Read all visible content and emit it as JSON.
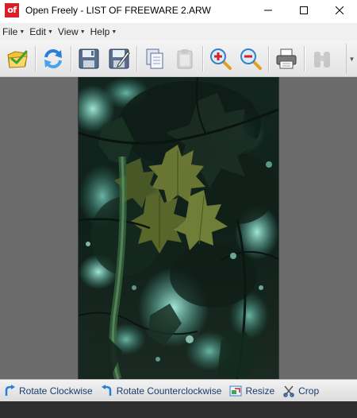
{
  "window": {
    "app_icon_text": "of",
    "title": "Open Freely - LIST OF FREEWARE 2.ARW"
  },
  "menu": [
    {
      "label": "File"
    },
    {
      "label": "Edit"
    },
    {
      "label": "View"
    },
    {
      "label": "Help"
    }
  ],
  "toolbar": {
    "buttons": [
      "open-folder-icon",
      "refresh-icon",
      "save-icon",
      "save-as-icon",
      "copy-icon",
      "paste-icon",
      "zoom-in-icon",
      "zoom-out-icon",
      "print-icon",
      "binoculars-icon"
    ]
  },
  "actions": [
    {
      "label": "Rotate Clockwise",
      "icon": "rotate-clockwise-icon"
    },
    {
      "label": "Rotate Counterclockwise",
      "icon": "rotate-counterclockwise-icon"
    },
    {
      "label": "Resize",
      "icon": "resize-icon"
    },
    {
      "label": "Crop",
      "icon": "crop-icon"
    }
  ],
  "colors": {
    "app_icon_bg": "#d61f26",
    "viewer_bg": "#6b6b6b",
    "action_text": "#1a3d6e"
  }
}
